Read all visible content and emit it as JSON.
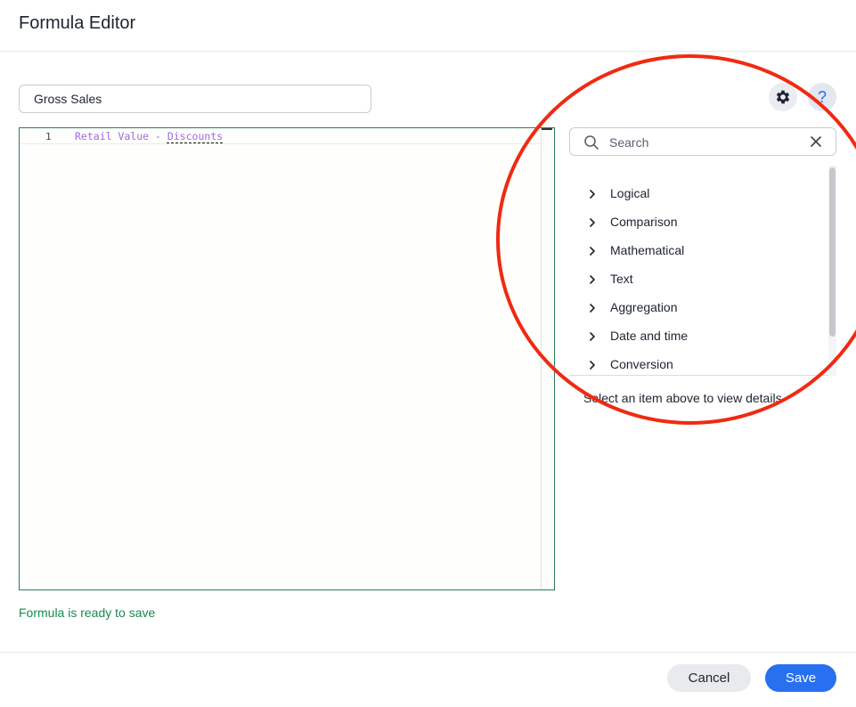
{
  "dialog": {
    "title": "Formula Editor"
  },
  "formula": {
    "name": "Gross Sales",
    "line_number": "1",
    "code_prefix": "Retail Value - ",
    "code_ref": "Discounts",
    "status": "Formula is ready to save",
    "status_color": "#188a4e"
  },
  "toolbar": {
    "settings_icon": "gear-icon",
    "help_label": "?",
    "help_icon": "help-icon"
  },
  "search": {
    "placeholder": "Search",
    "value": ""
  },
  "function_categories": [
    {
      "label": "Logical"
    },
    {
      "label": "Comparison"
    },
    {
      "label": "Mathematical"
    },
    {
      "label": "Text"
    },
    {
      "label": "Aggregation"
    },
    {
      "label": "Date and time"
    },
    {
      "label": "Conversion"
    }
  ],
  "details": {
    "hint": "Select an item above to view details"
  },
  "footer": {
    "cancel_label": "Cancel",
    "save_label": "Save"
  },
  "colors": {
    "accent": "#2770ef",
    "editor_border": "#2c7a5b",
    "code": "#a06ae0",
    "annotation": "#f02a12"
  }
}
